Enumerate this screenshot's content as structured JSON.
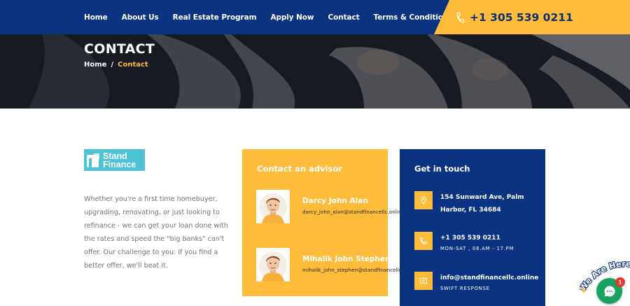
{
  "nav": {
    "items": [
      "Home",
      "About Us",
      "Real Estate Program",
      "Apply Now",
      "Contact",
      "Terms & Conditions"
    ],
    "phone": "+1 305 539 0211"
  },
  "hero": {
    "title": "CONTACT",
    "breadcrumb": {
      "home": "Home",
      "separator": "/",
      "current": "Contact"
    }
  },
  "logo": {
    "line1": "Stand",
    "line2": "Finance"
  },
  "about_text": "Whether you're a first time homebuyer, upgrading, renovating, or just looking to refinance - we can get your loan done with the rates and speed the \"big banks\" can't offer. Our challenge to you: If you find a better offer, we'll beat it.",
  "advisor_card": {
    "title": "Contact an advisor",
    "advisors": [
      {
        "name": "Darcy John Alan",
        "email": "darcy_john_alan@standfinancellc.online"
      },
      {
        "name": "Mihalik John Stephen",
        "email": "mihalik_john_stephen@standfinancellc.online"
      }
    ]
  },
  "touch_card": {
    "title": "Get in touch",
    "address": "154 Sunward Ave, Palm Harbor, FL 34684",
    "phone": "+1 305 539 0211",
    "hours": "MON-SAT , 08.AM - 17.PM",
    "email": "info@standfinancellc.online",
    "email_note": "SWIFT RESPONSE"
  },
  "chat": {
    "label": "We Are Here!",
    "badge": "1"
  },
  "colors": {
    "navy": "#0a3482",
    "accent": "#ffbc3b",
    "logo_bg": "#4fc3d6",
    "chat_green": "#1aa260"
  },
  "icons": [
    "phone-icon",
    "location-pin-icon",
    "phone-icon",
    "email-icon",
    "whatsapp-chat-icon"
  ]
}
